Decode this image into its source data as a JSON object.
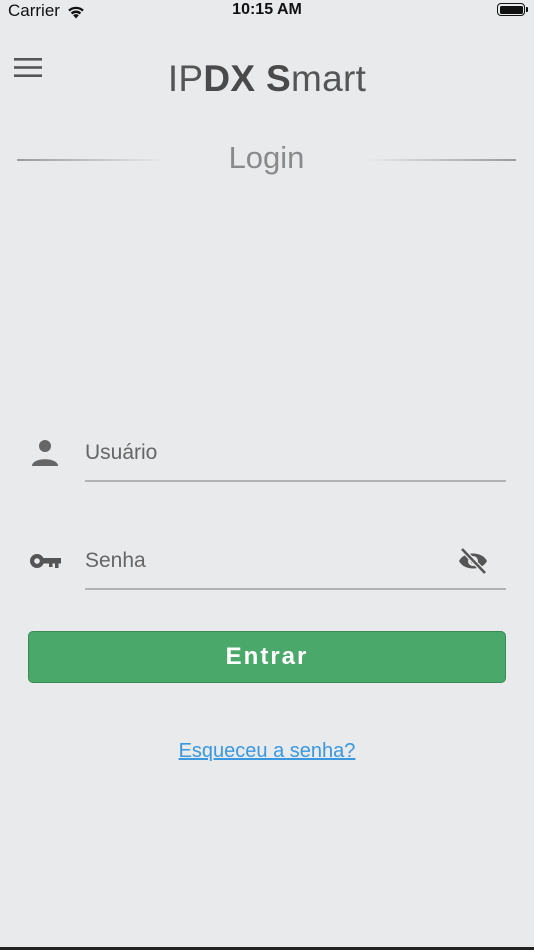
{
  "status_bar": {
    "carrier": "Carrier",
    "time": "10:15 AM",
    "icons": [
      "wifi-icon",
      "battery-icon"
    ]
  },
  "header": {
    "menu_icon": "hamburger-menu-icon",
    "title_parts": {
      "ip": "IP",
      "dx": "DX",
      "space": " ",
      "s": "S",
      "mart": "mart"
    }
  },
  "login_section": {
    "heading": "Login"
  },
  "form": {
    "username": {
      "placeholder": "Usuário",
      "value": "",
      "icon": "person-icon"
    },
    "password": {
      "placeholder": "Senha",
      "value": "",
      "icon": "key-icon",
      "toggle_icon": "eye-off-icon"
    },
    "submit_label": "Entrar",
    "forgot_password_label": "Esqueceu a senha?"
  },
  "colors": {
    "background": "#e9eaec",
    "primary_button": "#4aa86a",
    "link": "#3a98e0"
  }
}
